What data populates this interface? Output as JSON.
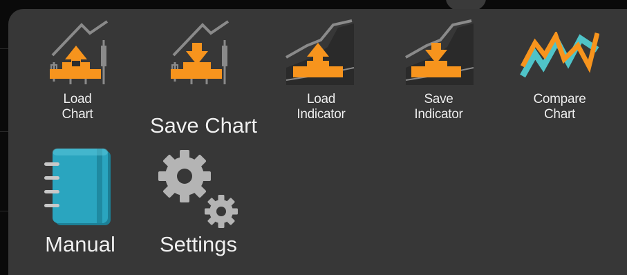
{
  "menu": {
    "row1": [
      {
        "line1": "Load",
        "line2": "Chart",
        "icon": "load-chart-icon"
      },
      {
        "label": "Save Chart",
        "icon": "save-chart-icon"
      },
      {
        "line1": "Load",
        "line2": "Indicator",
        "icon": "load-indicator-icon"
      },
      {
        "line1": "Save",
        "line2": "Indicator",
        "icon": "save-indicator-icon"
      },
      {
        "line1": "Compare",
        "line2": "Chart",
        "icon": "compare-chart-icon"
      }
    ],
    "row2": [
      {
        "label": "Manual",
        "icon": "manual-notebook-icon"
      },
      {
        "label": "Settings",
        "icon": "settings-gears-icon"
      }
    ]
  },
  "colors": {
    "panel": "#373737",
    "accent_orange": "#f7941d",
    "compare_teal": "#4fc3c8",
    "manual_teal": "#2aa5bf",
    "gear_gray": "#b4b4b4",
    "label_text": "#f0f0f0"
  }
}
